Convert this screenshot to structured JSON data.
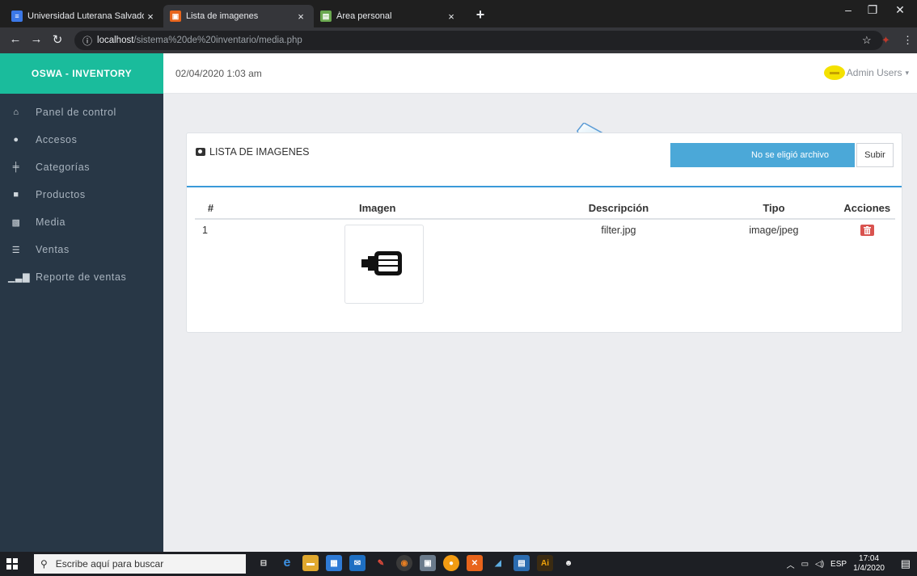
{
  "browser": {
    "tabs": [
      {
        "title": "Universidad Luterana Salvadoreñ",
        "favicon_color": "#3b78e7"
      },
      {
        "title": "Lista de imagenes",
        "favicon_color": "#e8641b"
      },
      {
        "title": "Área personal",
        "favicon_color": "#6aa84f"
      }
    ],
    "close_glyph": "×",
    "new_tab_glyph": "+",
    "address": {
      "host": "localhost",
      "path": "/sistema%20de%20inventario/media.php"
    }
  },
  "sidebar": {
    "brand": "OSWA - INVENTORY",
    "items": [
      {
        "label": "Panel de control",
        "icon": "home-icon"
      },
      {
        "label": "Accesos",
        "icon": "user-icon"
      },
      {
        "label": "Categorías",
        "icon": "tree-icon"
      },
      {
        "label": "Productos",
        "icon": "grid-icon"
      },
      {
        "label": "Media",
        "icon": "image-icon"
      },
      {
        "label": "Ventas",
        "icon": "list-icon"
      },
      {
        "label": "Reporte de ventas",
        "icon": "bar-chart-icon"
      }
    ]
  },
  "header": {
    "datetime": "02/04/2020 1:03 am",
    "user": "Admin Users"
  },
  "panel": {
    "title": "LISTA DE IMAGENES",
    "file_input_text": "No se eligió archivo",
    "upload_label": "Subir",
    "columns": [
      "#",
      "Imagen",
      "Descripción",
      "Tipo",
      "Acciones"
    ],
    "rows": [
      {
        "num": "1",
        "description": "filter.jpg",
        "type": "image/jpeg"
      }
    ]
  },
  "taskbar": {
    "search_placeholder": "Escribe aquí para buscar",
    "language": "ESP",
    "time": "17:04",
    "date": "1/4/2020"
  },
  "colors": {
    "brand": "#1abc9c",
    "sidebar": "#283746",
    "accent": "#4ba8d8",
    "danger": "#d9534f"
  }
}
